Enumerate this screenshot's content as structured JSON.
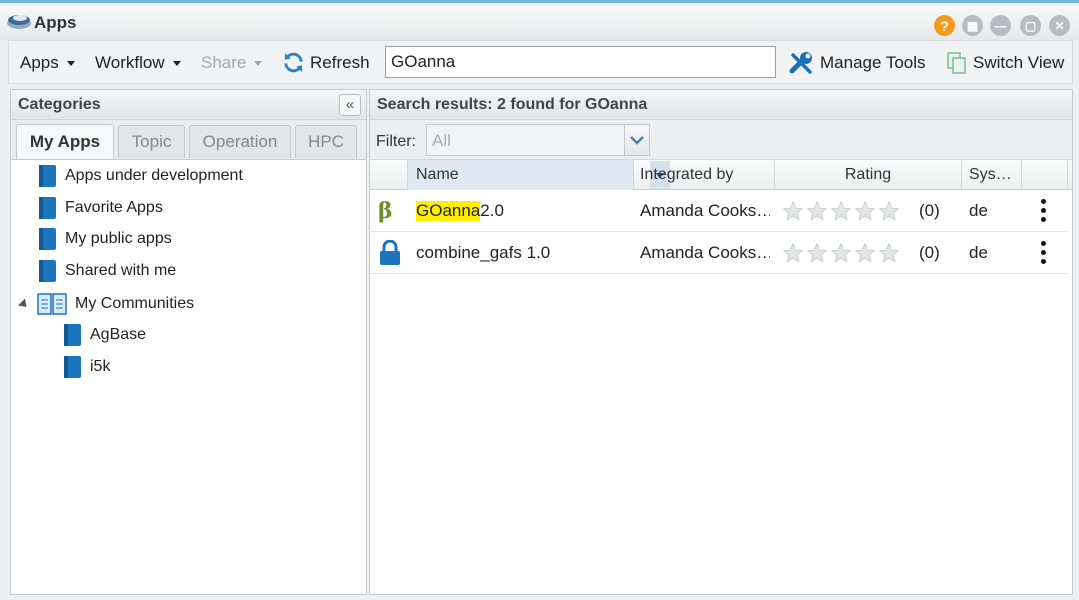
{
  "window": {
    "title": "Apps"
  },
  "toolbar": {
    "apps_label": "Apps",
    "workflow_label": "Workflow",
    "share_label": "Share",
    "refresh_label": "Refresh",
    "search_value": "GOanna",
    "manage_tools_label": "Manage Tools",
    "switch_view_label": "Switch View"
  },
  "categories": {
    "title": "Categories",
    "tabs": [
      "My Apps",
      "Topic",
      "Operation",
      "HPC"
    ],
    "active_tab": "My Apps",
    "tree": [
      {
        "label": "Apps under development",
        "icon": "book-icon"
      },
      {
        "label": "Favorite Apps",
        "icon": "book-icon"
      },
      {
        "label": "My public apps",
        "icon": "book-icon"
      },
      {
        "label": "Shared with me",
        "icon": "book-icon"
      },
      {
        "label": "My Communities",
        "icon": "open-book-icon",
        "expanded": true
      },
      {
        "label": "AgBase",
        "icon": "book-icon"
      },
      {
        "label": "i5k",
        "icon": "book-icon"
      }
    ]
  },
  "results": {
    "header": "Search results: 2 found for GOanna",
    "filter_label": "Filter:",
    "filter_value": "All",
    "columns": [
      "Name",
      "Integrated by",
      "Rating",
      "Sys…"
    ],
    "rows": [
      {
        "icon": "beta-icon",
        "name_highlight": "GOanna",
        "name_rest": " 2.0",
        "integrated_by": "Amanda Cooks…",
        "rating_count": "(0)",
        "system": "de"
      },
      {
        "icon": "lock-icon",
        "name_highlight": "",
        "name_rest": "combine_gafs 1.0",
        "integrated_by": "Amanda Cooks…",
        "rating_count": "(0)",
        "system": "de"
      }
    ]
  },
  "colors": {
    "accent": "#1a75bb",
    "highlight": "#ffee00",
    "help": "#f39c1c"
  }
}
